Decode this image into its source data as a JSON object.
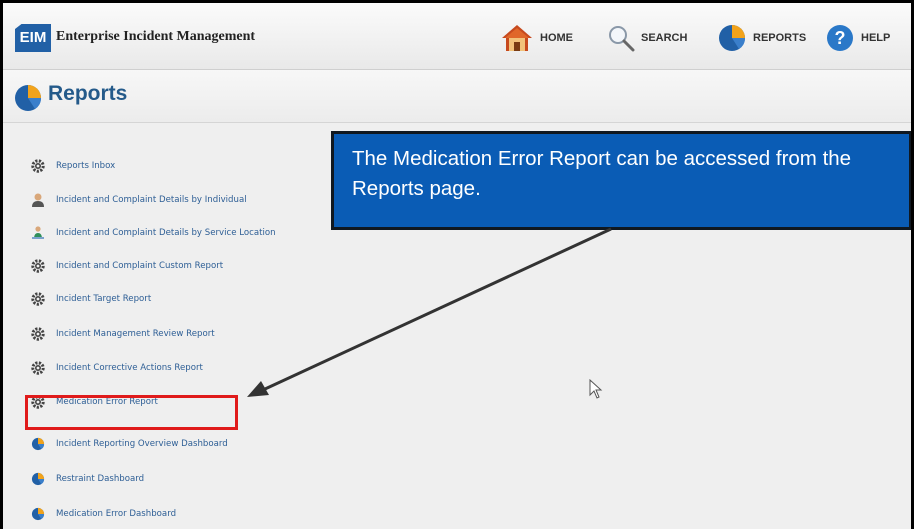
{
  "app": {
    "logo_text": "EIM",
    "title": "Enterprise Incident Management"
  },
  "nav": {
    "home": "HOME",
    "search": "SEARCH",
    "reports": "REPORTS",
    "help": "HELP"
  },
  "page": {
    "title": "Reports"
  },
  "reports": [
    {
      "label": "Reports Inbox",
      "icon": "gear-icon"
    },
    {
      "label": "Incident and Complaint Details by Individual",
      "icon": "person-icon"
    },
    {
      "label": "Incident and Complaint Details by Service Location",
      "icon": "location-pin-icon"
    },
    {
      "label": "Incident and Complaint Custom Report",
      "icon": "gear-icon"
    },
    {
      "label": "Incident Target Report",
      "icon": "gear-icon"
    },
    {
      "label": "Incident Management Review Report",
      "icon": "gear-icon"
    },
    {
      "label": "Incident Corrective Actions Report",
      "icon": "gear-icon"
    },
    {
      "label": "Medication Error Report",
      "icon": "gear-icon"
    },
    {
      "label": "Incident Reporting Overview Dashboard",
      "icon": "pie-chart-icon"
    },
    {
      "label": "Restraint Dashboard",
      "icon": "pie-chart-icon"
    },
    {
      "label": "Medication Error Dashboard",
      "icon": "pie-chart-icon"
    }
  ],
  "callout": {
    "text": "The Medication Error Report can be accessed from the Reports page."
  },
  "colors": {
    "accent_blue": "#0a5cb5",
    "link_blue": "#2d5e95",
    "highlight_red": "#e01b1b",
    "pie_blue": "#2160a6",
    "pie_orange": "#f2a31b"
  }
}
